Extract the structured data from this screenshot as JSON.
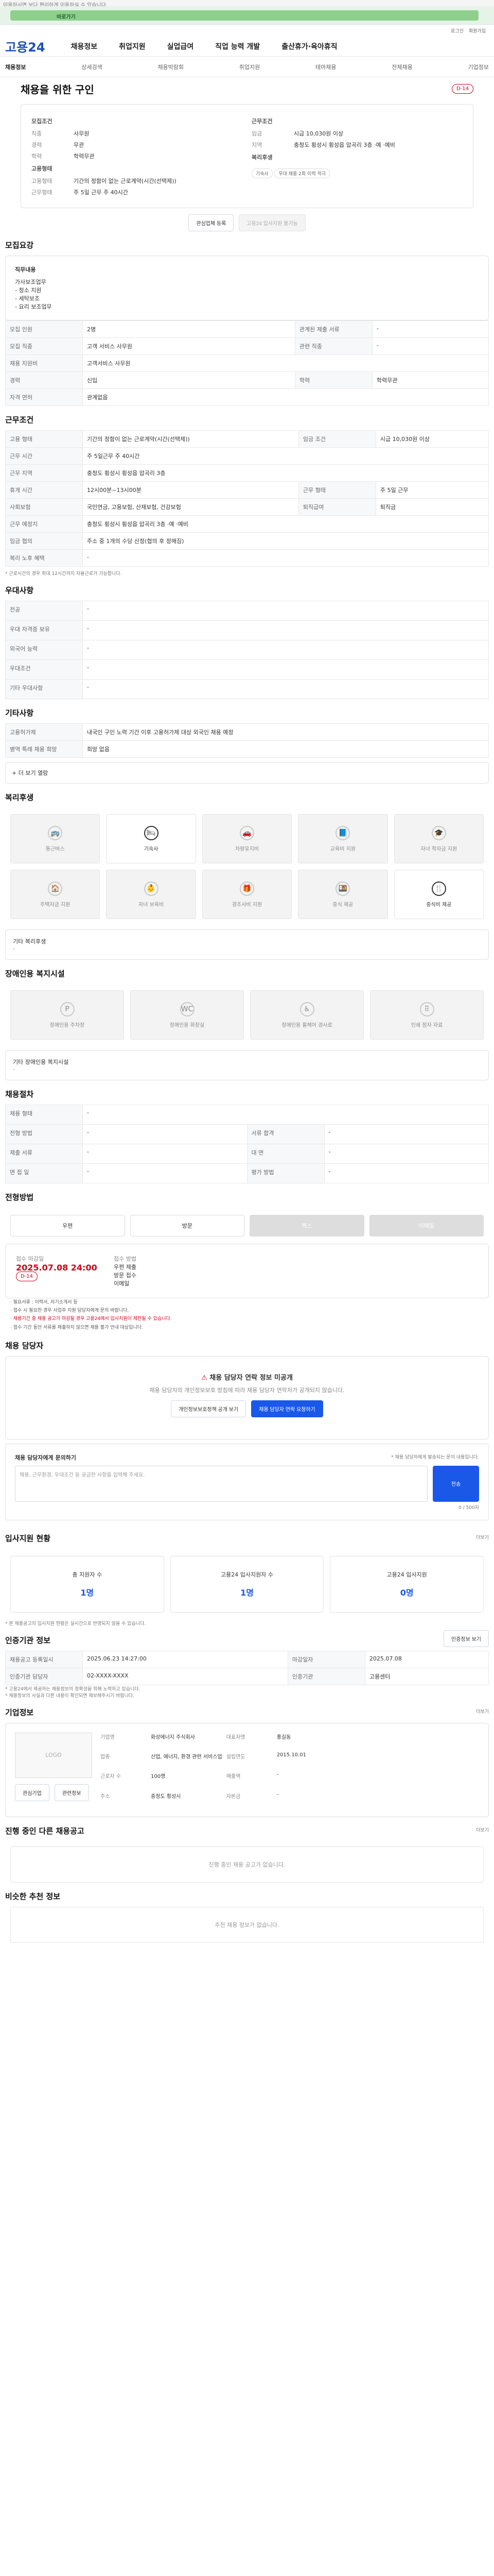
{
  "top": {
    "notice": "이용하시면 보다 편리하게 이용하실 수 있습니다.",
    "bar": "바로가기",
    "util": [
      "로그인",
      "회원가입"
    ]
  },
  "nav": {
    "logo": "고용24",
    "menus": [
      "채용정보",
      "취업지원",
      "실업급여",
      "직업 능력 개발",
      "출산휴가·육아휴직"
    ]
  },
  "tabs": [
    "채용정보",
    "상세검색",
    "채용박람회",
    "취업지원",
    "테마채용",
    "전체채용",
    "기업정보"
  ],
  "header": {
    "title": "채용을 위한 구인",
    "badge": "D-14"
  },
  "summary": {
    "left": {
      "group": "모집조건",
      "job_label": "직종",
      "job": "사무원",
      "career_label": "경력",
      "career": "무관",
      "edu_label": "학력",
      "edu": "학력무관",
      "welfare_label": "고용형태",
      "employment": "기간의 정함이 없는 근로계약(시간(선택제))",
      "work_label": "근무형태",
      "work": "주 5일 근무 주 40시간"
    },
    "right": {
      "group": "근무조건",
      "wage_label": "임금",
      "wage": "시급 10,030원 이상",
      "location_label": "지역",
      "location": "충청도 횡성시 횡성읍 압곡리 3층 ·예 ·예비",
      "extra_title": "복리후생",
      "pills": [
        "기숙사",
        "우대 채용 2회 이력 적극"
      ]
    }
  },
  "buttons": {
    "scrap": "관심업체 등록",
    "apply": "고용24 입사지원 불가능"
  },
  "recruitment": {
    "title": "모집요강",
    "detail_title": "직무내용",
    "details": [
      "가사보조업무",
      "- 청소 지원",
      "- 세탁보조",
      "- 요리 보조업무"
    ],
    "rows": [
      [
        "모집 인원",
        "2명",
        "관계된 제출 서류",
        "-"
      ],
      [
        "모집 직종",
        "고객 서비스 사무원",
        "관련 직종",
        "-"
      ],
      [
        "채용 지원비",
        "고객서비스 사무원",
        "",
        ""
      ],
      [
        "경력",
        "신입",
        "학력",
        "학력무관"
      ],
      [
        "자격 면허",
        "관계없음",
        "",
        ""
      ]
    ]
  },
  "conditions": {
    "title": "근무조건",
    "rows": [
      [
        "고용 형태",
        "기간의 정함이 없는 근로계약(시간(선택제))",
        "임금 조건",
        "시급 10,030원 이상"
      ],
      [
        "근무 시간",
        "주 5일근무 주 40시간",
        "",
        ""
      ],
      [
        "근무 지역",
        "충청도 횡성시 횡성읍 압곡리 3층",
        "",
        ""
      ],
      [
        "휴게 시간",
        "12시00분~13시00분",
        "근무 형태",
        "주 5일 근무"
      ],
      [
        "사회보험",
        "국민연금, 고용보험, 산재보험, 건강보험",
        "퇴직급여",
        "퇴직금"
      ],
      [
        "근무 예정지",
        "충청도 횡성시 횡성읍 압곡리 3층 ·예 ·예비",
        "",
        ""
      ],
      [
        "임금 협의",
        "주소 중 1개의 수당 산정(협의 후 정해짐)",
        "",
        ""
      ],
      [
        "복리 노후 혜택",
        "-",
        "",
        ""
      ]
    ],
    "note": "* 근로시간의 경우 최대 12시간까지 자율근로가 가능합니다."
  },
  "preference": {
    "title": "우대사항",
    "rows": [
      [
        "전공",
        "-"
      ],
      [
        "우대 자격증 보유",
        "-"
      ],
      [
        "외국어 능력",
        "-"
      ],
      [
        "우대조건",
        "-"
      ],
      [
        "기타 우대사항",
        "-"
      ]
    ]
  },
  "other": {
    "title": "기타사항",
    "rows": [
      [
        "고용허가제",
        "내국인 구인 노력 기간 이후 고용허가제 대상 외국인 채용 예정"
      ],
      [
        "병역 특례 채용 희망",
        "희망 없음"
      ]
    ],
    "more": "+ 더 보기 열람"
  },
  "welfare": {
    "title": "복리후생",
    "items": [
      "통근버스",
      "기숙사",
      "차량유지비",
      "교육비 지원",
      "자녀 학자금 지원",
      "주택자금 지원",
      "자녀 보육비",
      "경조사비 지원",
      "중식 제공",
      "중식비 제공"
    ],
    "note": "기타 복리후생",
    "value": "-"
  },
  "disability": {
    "title": "장애인용 복지시설",
    "items": [
      "장애인용 주차장",
      "장애인용 화장실",
      "장애인용 휠체어 경사로",
      "인쇄 점자 자료"
    ],
    "note": "기타 장애인용 복지시설",
    "value": "-"
  },
  "process": {
    "title": "채용절차",
    "rows": [
      [
        "채용 형태",
        "-",
        "",
        ""
      ],
      [
        "전형 방법",
        "-",
        "서류 합격",
        "-"
      ],
      [
        "제출 서류",
        "-",
        "대 면",
        "-"
      ],
      [
        "면 접 일",
        "-",
        "평가 방법",
        "-"
      ]
    ]
  },
  "apply": {
    "title": "전형방법",
    "methods": [
      "우편",
      "방문",
      "팩스",
      "이메일"
    ],
    "deadline_title": "접수 마감일",
    "deadline": "2025.07.08 24:00",
    "deadline_badge": "D-14",
    "method_title": "접수 방법",
    "method_values": [
      "우편 제출",
      "방문 접수",
      "이메일"
    ],
    "notes": [
      "· 필요서류 : 이력서, 자기소개서 등",
      "· 접수 시 필요한 경우 사업주 지원 담당자에게 문의 바랍니다.",
      "· 채용기간 중 채용 공고가 마감될 경우 고용24에서 입사지원이 제한될 수 있습니다.",
      "· 접수 기간 동안 서류를 제출하지 않으면 채용 불가 안내 대상입니다."
    ]
  },
  "contact": {
    "title": "채용 담당자",
    "alert": "채용 담당자 연락 정보 미공개",
    "desc": "채용 담당자의 개인정보보호 방침에 따라 채용 담당자 연락처가 공개되지 않습니다.",
    "btn1": "개인정보보호정책 공개 보기",
    "btn2": "채용 담당자 연락 요청하기"
  },
  "inquiry": {
    "title": "채용 담당자에게 문의하기",
    "hint": "* 채용 담당자에게 발송되는 문의 내용입니다.",
    "placeholder": "채용, 근무환경, 우대조건 등 궁금한 사항을 입력해 주세요.",
    "count": "0 / 500자",
    "submit": "전송"
  },
  "applicants": {
    "title": "입사지원 현황",
    "more": "더보기",
    "cards": [
      [
        "총 지원자 수",
        "1명"
      ],
      [
        "고용24 입사지원자 수",
        "1명"
      ],
      [
        "고용24 입사지원",
        "0명"
      ]
    ],
    "note": "* 본 채용공고의 입사지원 현황은 실시간으로 반영되지 않을 수 있습니다."
  },
  "agency": {
    "title": "인증기관 정보",
    "button": "인증정보 보기",
    "rows": [
      [
        "채용공고 등록일시",
        "2025.06.23 14:27:00",
        "마감일자",
        "2025.07.08"
      ],
      [
        "인증기관 담당자",
        "02-XXXX-XXXX",
        "인증기관",
        "고용센터"
      ]
    ],
    "notes": [
      "* 고용24에서 제공하는 채용정보의 정확성을 위해 노력하고 있습니다.",
      "* 채용정보의 사실과 다른 내용이 확인되면 제보해주시기 바랍니다."
    ]
  },
  "company": {
    "title": "기업정보",
    "more": "더보기",
    "logo": "LOGO",
    "buttons": [
      "관심기업",
      "관련정보"
    ],
    "fields": [
      [
        "기업명",
        "화성에너지 주식회사"
      ],
      [
        "대표자명",
        "홍길동"
      ],
      [
        "업종",
        "산업, 에너지, 환경 관련 서비스업"
      ],
      [
        "설립연도",
        "2015.10.01"
      ],
      [
        "근로자 수",
        "100명"
      ],
      [
        "매출액",
        "-"
      ],
      [
        "주소",
        "충청도 횡성시"
      ],
      [
        "자본금",
        "-"
      ]
    ]
  },
  "related": {
    "title": "진행 중인 다른 채용공고",
    "more": "더보기",
    "empty": "진행 중인 채용 공고가 없습니다."
  },
  "recommend": {
    "title": "비슷한 추천 정보",
    "empty": "추천 채용 정보가 없습니다."
  }
}
